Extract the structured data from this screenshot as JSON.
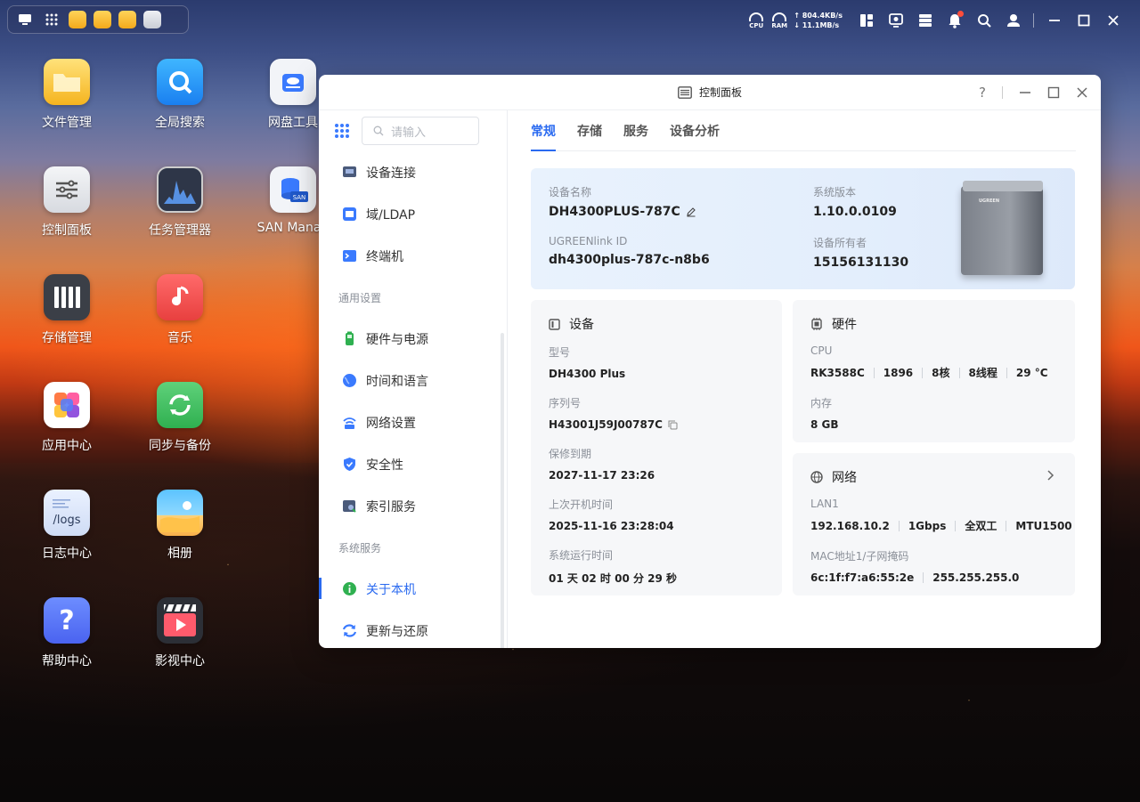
{
  "desktop": {
    "icons": [
      {
        "label": "文件管理"
      },
      {
        "label": "全局搜索"
      },
      {
        "label": "网盘工具"
      },
      {
        "label": "控制面板"
      },
      {
        "label": "任务管理器"
      },
      {
        "label": "SAN Manag"
      },
      {
        "label": "存储管理"
      },
      {
        "label": "音乐"
      },
      {
        "label": "应用中心"
      },
      {
        "label": "同步与备份"
      },
      {
        "label": "日志中心"
      },
      {
        "label": "相册"
      },
      {
        "label": "帮助中心"
      },
      {
        "label": "影视中心"
      }
    ]
  },
  "topbar": {
    "cpu_label": "CPU",
    "ram_label": "RAM",
    "upload_speed": "↑ 804.4KB/s",
    "download_speed": "↓ 11.1MB/s"
  },
  "window": {
    "title": "控制面板",
    "help": "?",
    "search_placeholder": "请输入",
    "sidebar": {
      "items_top": [
        {
          "label": "设备连接"
        },
        {
          "label": "域/LDAP"
        },
        {
          "label": "终端机"
        }
      ],
      "section_general": "通用设置",
      "items_general": [
        {
          "label": "硬件与电源"
        },
        {
          "label": "时间和语言"
        },
        {
          "label": "网络设置"
        },
        {
          "label": "安全性"
        },
        {
          "label": "索引服务"
        }
      ],
      "section_system": "系统服务",
      "items_system": [
        {
          "label": "关于本机"
        },
        {
          "label": "更新与还原"
        }
      ]
    },
    "tabs": [
      "常规",
      "存储",
      "服务",
      "设备分析"
    ],
    "hero": {
      "device_name_label": "设备名称",
      "device_name": "DH4300PLUS-787C",
      "ugreenlink_label": "UGREENlink ID",
      "ugreenlink": "dh4300plus-787c-n8b6",
      "version_label": "系统版本",
      "version": "1.10.0.0109",
      "owner_label": "设备所有者",
      "owner": "15156131130",
      "nas_brand": "UGREEN"
    },
    "device_card": {
      "title": "设备",
      "model_label": "型号",
      "model": "DH4300 Plus",
      "serial_label": "序列号",
      "serial": "H43001J59J00787C",
      "warranty_label": "保修到期",
      "warranty": "2027-11-17 23:26",
      "last_boot_label": "上次开机时间",
      "last_boot": "2025-11-16 23:28:04",
      "uptime_label": "系统运行时间",
      "uptime": "01 天 02 时 00 分 29 秒"
    },
    "hardware_card": {
      "title": "硬件",
      "cpu_label": "CPU",
      "cpu": [
        "RK3588C",
        "1896",
        "8核",
        "8线程",
        "29 °C"
      ],
      "mem_label": "内存",
      "mem": "8 GB"
    },
    "network_card": {
      "title": "网络",
      "lan_label": "LAN1",
      "lan": [
        "192.168.10.2",
        "1Gbps",
        "全双工",
        "MTU1500"
      ],
      "mac_label": "MAC地址1/子网掩码",
      "mac": [
        "6c:1f:f7:a6:55:2e",
        "255.255.255.0"
      ]
    }
  }
}
